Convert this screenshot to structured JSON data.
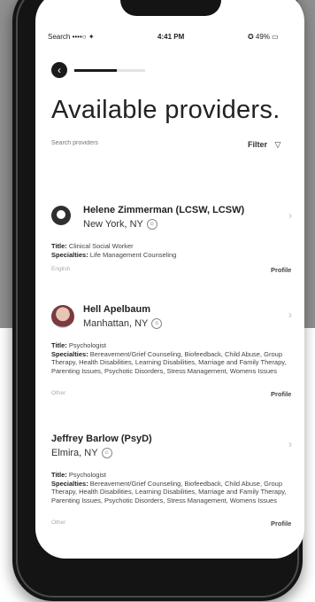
{
  "status_bar": {
    "carrier": "Search ••••○ ✦",
    "time": "4:41 PM",
    "battery": "✪ 49% ▭"
  },
  "header": {
    "back_glyph": "‹",
    "progress": 0.6,
    "title": "Available providers."
  },
  "search": {
    "placeholder": "Search providers",
    "filter_label": "Filter",
    "filter_icon": "▽"
  },
  "chevron": "›",
  "loc_glyph": "☺",
  "providers": [
    {
      "name": "Helene Zimmerman (LCSW, LCSW)",
      "location": "New York, NY",
      "title_label": "Title:",
      "title": "Clinical Social Worker",
      "specialties_label": "Specialties:",
      "specialties": "Life Management Counseling",
      "language": "English",
      "profile": "Profile",
      "avatar": "silhouette"
    },
    {
      "name": "Hell Apelbaum",
      "location": "Manhattan, NY",
      "title_label": "Title:",
      "title": "Psychologist",
      "specialties_label": "Specialties:",
      "specialties": "Bereavement/Grief Counseling, Biofeedback, Child Abuse, Group Therapy, Health Disabilities, Learning Disabilities, Marriage and Family Therapy, Parenting Issues, Psychotic Disorders, Stress Management, Womens Issues",
      "language": "Other",
      "profile": "Profile",
      "avatar": "photo"
    },
    {
      "name": "Jeffrey Barlow (PsyD)",
      "location": "Elmira, NY",
      "title_label": "Title:",
      "title": "Psychologist",
      "specialties_label": "Specialties:",
      "specialties": "Bereavement/Grief Counseling, Biofeedback, Child Abuse, Group Therapy, Health Disabilities, Learning Disabilities, Marriage and Family Therapy, Parenting Issues, Psychotic Disorders, Stress Management, Womens Issues",
      "language": "Other",
      "profile": "Profile",
      "avatar": "none"
    }
  ]
}
